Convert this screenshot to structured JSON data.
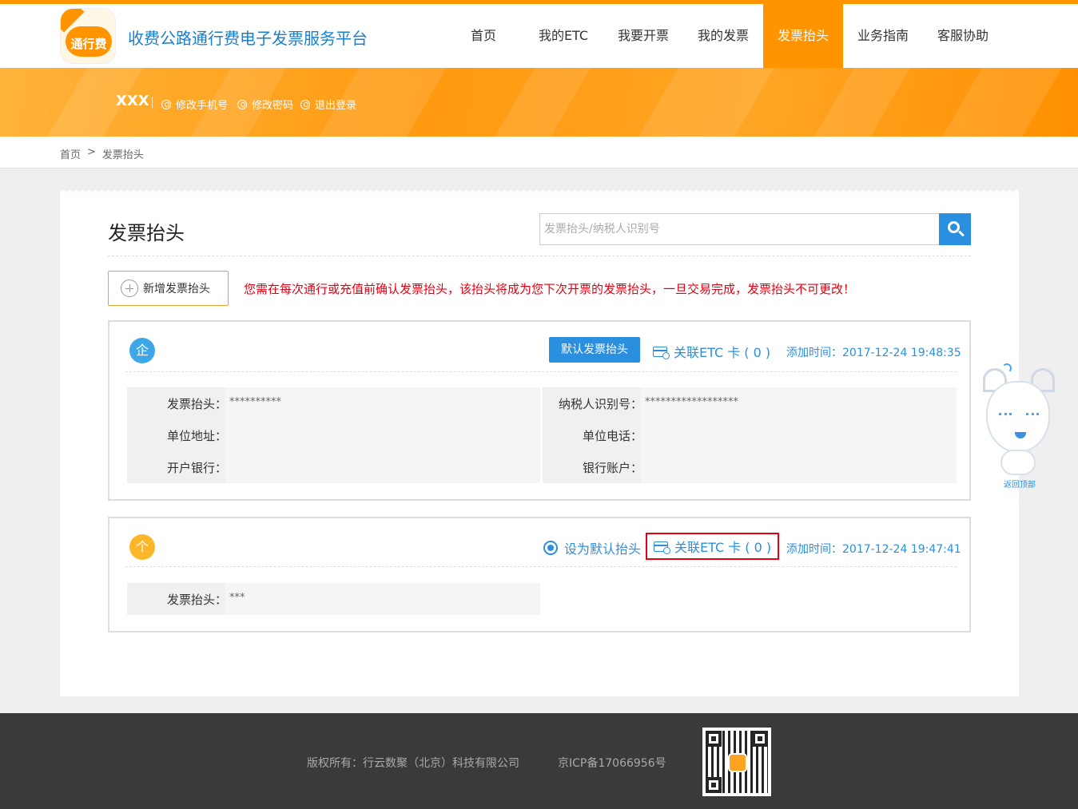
{
  "header": {
    "logo_text": "通行费",
    "site_title": "收费公路通行费电子发票服务平台",
    "nav": [
      {
        "label": "首页"
      },
      {
        "label": "我的ETC"
      },
      {
        "label": "我要开票"
      },
      {
        "label": "我的发票"
      },
      {
        "label": "发票抬头",
        "active": true
      },
      {
        "label": "业务指南"
      },
      {
        "label": "客服协助"
      }
    ],
    "accent_color": "#ff9400"
  },
  "banner": {
    "username": "XXX",
    "links": [
      "修改手机号",
      "修改密码",
      "退出登录"
    ]
  },
  "breadcrumb": {
    "home": "首页",
    "separator": ">",
    "current": "发票抬头"
  },
  "main": {
    "title": "发票抬头",
    "search_placeholder": "发票抬头/纳税人识别号",
    "add_button": "新增发票抬头",
    "warning": "您需在每次通行或充值前确认发票抬头，该抬头将成为您下次开票的发票抬头，一旦交易完成，发票抬头不可更改！",
    "cards": [
      {
        "type_badge": "企",
        "default_button": "默认发票抬头",
        "etc_link": "关联ETC 卡 ( 0 )",
        "added_time": "添加时间：2017-12-24 19:48:35",
        "fields": {
          "title_label": "发票抬头：",
          "title_value": "**********",
          "tax_label": "纳税人识别号：",
          "tax_value": "******************",
          "address_label": "单位地址：",
          "address_value": "",
          "phone_label": "单位电话：",
          "phone_value": "",
          "bank_label": "开户银行：",
          "bank_value": "",
          "account_label": "银行账户：",
          "account_value": ""
        }
      },
      {
        "type_badge": "个",
        "set_default": "设为默认抬头",
        "etc_link": "关联ETC 卡 ( 0 )",
        "added_time": "添加时间：2017-12-24 19:47:41",
        "fields": {
          "title_label": "发票抬头：",
          "title_value": "***"
        }
      }
    ]
  },
  "mascot": {
    "back_to_top": "返回顶部"
  },
  "footer": {
    "copyright": "版权所有：行云数聚（北京）科技有限公司",
    "icp": "京ICP备17066956号"
  }
}
